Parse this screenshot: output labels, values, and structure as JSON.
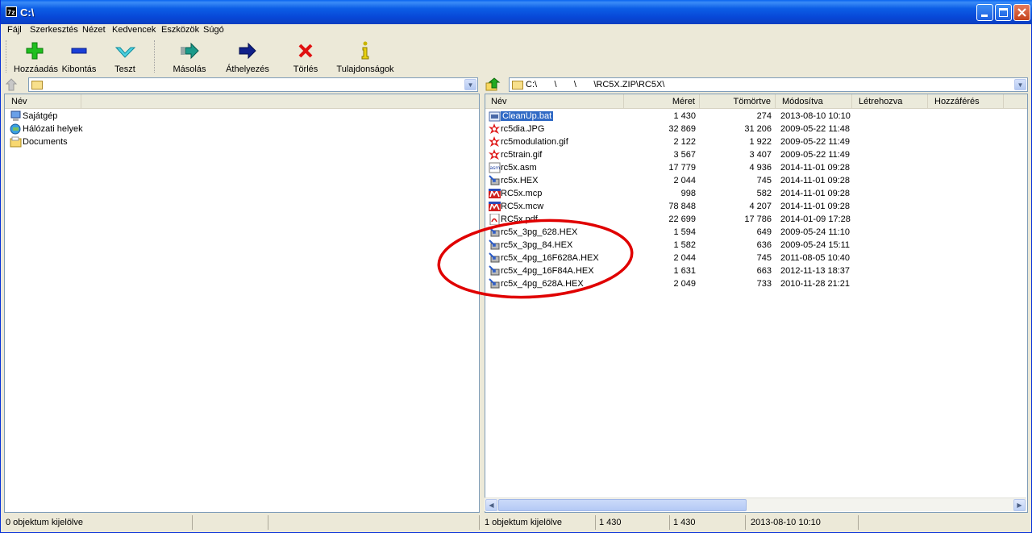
{
  "window": {
    "title": "C:\\",
    "app_icon": "7z"
  },
  "menu": [
    "Fájl",
    "Szerkesztés",
    "Nézet",
    "Kedvencek",
    "Eszközök",
    "Súgó"
  ],
  "toolbar": {
    "add": "Hozzáadás",
    "extract": "Kibontás",
    "test": "Teszt",
    "copy": "Másolás",
    "move": "Áthelyezés",
    "delete": "Törlés",
    "info": "Tulajdonságok"
  },
  "left_pane": {
    "path": "",
    "column_name": "Név",
    "items": [
      "Sajátgép",
      "Hálózati helyek",
      "Documents"
    ],
    "status": "0 objektum kijelölve"
  },
  "right_pane": {
    "path": "C:\\       \\       \\       \\RC5X.ZIP\\RC5X\\",
    "columns": {
      "name": "Név",
      "size": "Méret",
      "packed": "Tömörtve",
      "modified": "Módosítva",
      "created": "Létrehozva",
      "accessed": "Hozzáférés"
    },
    "files": [
      {
        "name": "CleanUp.bat",
        "size": "1 430",
        "packed": "274",
        "modified": "2013-08-10 10:10",
        "icon": "bat-icon",
        "selected": true
      },
      {
        "name": "rc5dia.JPG",
        "size": "32 869",
        "packed": "31 206",
        "modified": "2009-05-22 11:48",
        "icon": "image-icon"
      },
      {
        "name": "rc5modulation.gif",
        "size": "2 122",
        "packed": "1 922",
        "modified": "2009-05-22 11:49",
        "icon": "image-icon"
      },
      {
        "name": "rc5train.gif",
        "size": "3 567",
        "packed": "3 407",
        "modified": "2009-05-22 11:49",
        "icon": "image-icon"
      },
      {
        "name": "rc5x.asm",
        "size": "17 779",
        "packed": "4 936",
        "modified": "2014-11-01 09:28",
        "icon": "asm-icon"
      },
      {
        "name": "rc5x.HEX",
        "size": "2 044",
        "packed": "745",
        "modified": "2014-11-01 09:28",
        "icon": "hex-icon"
      },
      {
        "name": "RC5x.mcp",
        "size": "998",
        "packed": "582",
        "modified": "2014-11-01 09:28",
        "icon": "mplab-icon"
      },
      {
        "name": "RC5x.mcw",
        "size": "78 848",
        "packed": "4 207",
        "modified": "2014-11-01 09:28",
        "icon": "mplab-icon"
      },
      {
        "name": "RC5x.pdf",
        "size": "22 699",
        "packed": "17 786",
        "modified": "2014-01-09 17:28",
        "icon": "pdf-icon"
      },
      {
        "name": "rc5x_3pg_628.HEX",
        "size": "1 594",
        "packed": "649",
        "modified": "2009-05-24 11:10",
        "icon": "hex-icon"
      },
      {
        "name": "rc5x_3pg_84.HEX",
        "size": "1 582",
        "packed": "636",
        "modified": "2009-05-24 15:11",
        "icon": "hex-icon"
      },
      {
        "name": "rc5x_4pg_16F628A.HEX",
        "size": "2 044",
        "packed": "745",
        "modified": "2011-08-05 10:40",
        "icon": "hex-icon"
      },
      {
        "name": "rc5x_4pg_16F84A.HEX",
        "size": "1 631",
        "packed": "663",
        "modified": "2012-11-13 18:37",
        "icon": "hex-icon"
      },
      {
        "name": "rc5x_4pg_628A.HEX",
        "size": "2 049",
        "packed": "733",
        "modified": "2010-11-28 21:21",
        "icon": "hex-icon"
      }
    ],
    "status": {
      "selected": "1 objektum kijelölve",
      "size": "1 430",
      "packed": "1 430",
      "modified": "2013-08-10 10:10"
    }
  },
  "colors": {
    "annotation": "#e00000",
    "selection": "#316ac5",
    "titlebar": "#0a5ae0"
  }
}
